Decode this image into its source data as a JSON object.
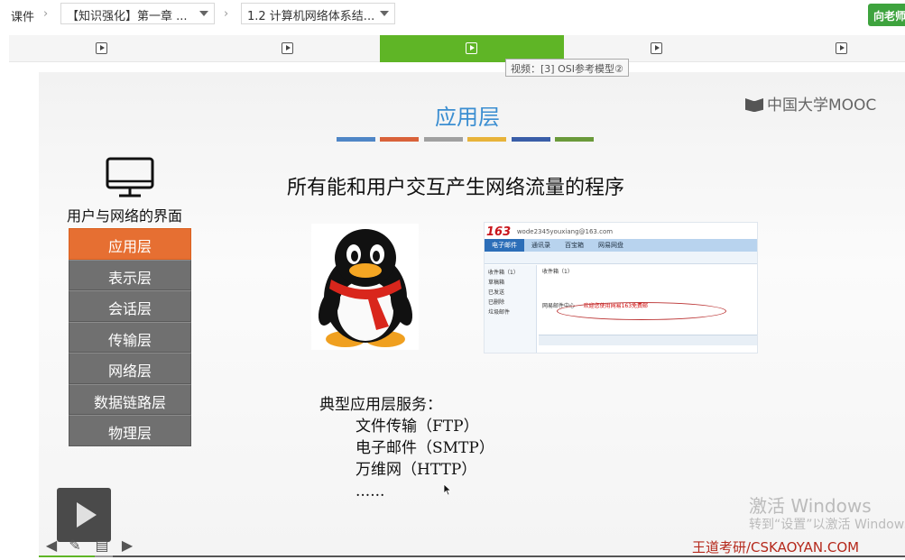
{
  "breadcrumb": {
    "root": "课件",
    "chapter_select": "【知识强化】第一章 ...",
    "section_select": "1.2 计算机网络体系结..."
  },
  "header": {
    "teacher_button": "向老师"
  },
  "tabs": {
    "count": 5,
    "active_index": 2
  },
  "tooltip": "视频：[3] OSI参考模型②",
  "slide": {
    "title": "应用层",
    "title_bar_colors": [
      "#4f86c6",
      "#d9623a",
      "#a0a0a0",
      "#e8b33a",
      "#3a5ea8",
      "#6a9a3a"
    ],
    "brand": "中国大学MOOC",
    "ui_label": "用户与网络的界面",
    "headline": "所有能和用户交互产生网络流量的程序",
    "layers": [
      "应用层",
      "表示层",
      "会话层",
      "传输层",
      "网络层",
      "数据链路层",
      "物理层"
    ],
    "active_layer_index": 0,
    "services_heading": "典型应用层服务：",
    "services": [
      "文件传输（FTP）",
      "电子邮件（SMTP）",
      "万维网（HTTP）",
      "......"
    ],
    "mail": {
      "logo": "163",
      "account": "wode2345youxiang@163.com",
      "tabs": [
        "电子邮件",
        "通讯录",
        "百宝箱",
        "网易网盘"
      ],
      "inbox_label": "收件箱（1）",
      "sidebar": [
        "收件箱（1）",
        "草稿箱",
        "已发送",
        "已删除",
        "垃圾邮件"
      ],
      "sender": "网易邮件中心",
      "subject": "欢迎您使用网易163免费邮"
    },
    "watermark_line1": "激活 Windows",
    "watermark_line2": "转到“设置”以激活 Windows",
    "site_credit": "王道考研/CSKAOYAN.COM"
  },
  "player": {
    "progress": 0.065,
    "buffered": 0.085
  },
  "icons": {
    "breadcrumb_separator": "chevron-right-icon",
    "tab": "video-play-icon",
    "monitor": "monitor-icon",
    "qq": "qq-penguin-icon",
    "play": "play-icon"
  }
}
